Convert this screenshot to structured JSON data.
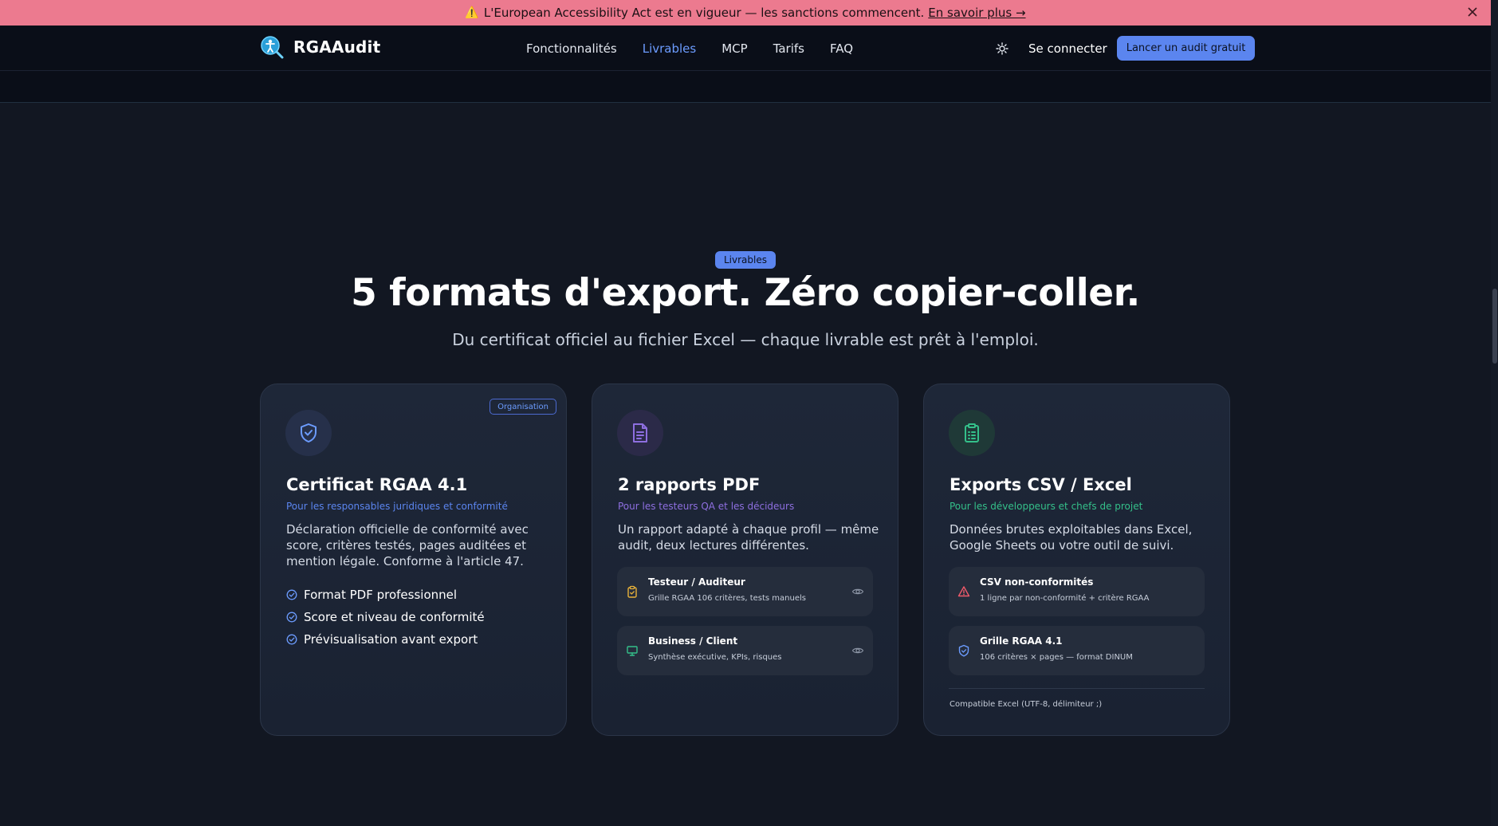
{
  "banner": {
    "text": "L'European Accessibility Act est en vigueur — les sanctions commencent.",
    "link": "En savoir plus →"
  },
  "header": {
    "logo_text": "RGAAudit",
    "nav": [
      {
        "label": "Fonctionnalités",
        "active": false
      },
      {
        "label": "Livrables",
        "active": true
      },
      {
        "label": "MCP",
        "active": false
      },
      {
        "label": "Tarifs",
        "active": false
      },
      {
        "label": "FAQ",
        "active": false
      }
    ],
    "login": "Se connecter",
    "cta": "Lancer un audit gratuit"
  },
  "section": {
    "pill": "Livrables",
    "title": "5 formats d'export. Zéro copier-coller.",
    "subtitle": "Du certificat officiel au fichier Excel — chaque livrable est prêt à l'emploi."
  },
  "cards": [
    {
      "badge": "Organisation",
      "icon": "shield-check-icon",
      "title": "Certificat RGAA 4.1",
      "audience": "Pour les responsables juridiques et conformité",
      "description": "Déclaration officielle de conformité avec score, critères testés, pages auditées et mention légale. Conforme à l'article 47.",
      "features": [
        "Format PDF professionnel",
        "Score et niveau de conformité",
        "Prévisualisation avant export"
      ]
    },
    {
      "icon": "document-icon",
      "title": "2 rapports PDF",
      "audience": "Pour les testeurs QA et les décideurs",
      "description": "Un rapport adapté à chaque profil — même audit, deux lectures différentes.",
      "items": [
        {
          "icon": "clipboard-icon",
          "title": "Testeur / Auditeur",
          "desc": "Grille RGAA 106 critères, tests manuels"
        },
        {
          "icon": "presentation-icon",
          "title": "Business / Client",
          "desc": "Synthèse exécutive, KPIs, risques"
        }
      ]
    },
    {
      "icon": "clipboard-list-icon",
      "title": "Exports CSV / Excel",
      "audience": "Pour les développeurs et chefs de projet",
      "description": "Données brutes exploitables dans Excel, Google Sheets ou votre outil de suivi.",
      "items": [
        {
          "icon": "warning-triangle-icon",
          "title": "CSV non-conformités",
          "desc": "1 ligne par non-conformité + critère RGAA"
        },
        {
          "icon": "shield-icon",
          "title": "Grille RGAA 4.1",
          "desc": "106 critères × pages — format DINUM"
        }
      ],
      "footnote": "Compatible Excel (UTF-8, délimiteur ;)"
    }
  ],
  "colors": {
    "accent_blue": "#5b85ef",
    "purple": "#8e6fe0",
    "green": "#34c08a",
    "banner": "#ec7a8f"
  }
}
